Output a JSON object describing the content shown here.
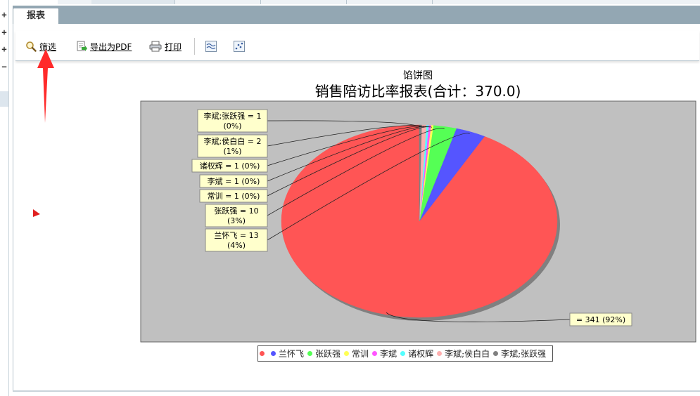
{
  "tab": {
    "label": "报表"
  },
  "toolbar": {
    "filter_label": "筛选",
    "export_pdf_label": "导出为PDF",
    "print_label": "打印"
  },
  "colors": {
    "tabbar": "#93a7b3",
    "plot_bg": "#c0c0c0",
    "label_bg": "#ffffcc",
    "arrow": "#ff2a2a"
  },
  "chart_data": {
    "type": "pie",
    "subtitle": "馅饼图",
    "title": "销售陪访比率报表(合计：370.0)",
    "total": 370.0,
    "series": [
      {
        "name": "兰怀飞",
        "value": 341,
        "label": "= 341 (92%)",
        "color": "#ff5555"
      },
      {
        "name": "张跃强",
        "value": 13,
        "label": "兰怀飞 = 13 (4%)",
        "color": "#5555ff"
      },
      {
        "name": "常训",
        "value": 10,
        "label": "张跃强 = 10 (3%)",
        "color": "#55ff55"
      },
      {
        "name": "李斌",
        "value": 1,
        "label": "常训 = 1 (0%)",
        "color": "#ffff55"
      },
      {
        "name": "诸权辉",
        "value": 1,
        "label": "李斌 = 1 (0%)",
        "color": "#ff55ff"
      },
      {
        "name": "李斌;侯白白",
        "value": 1,
        "label": "诸权辉 = 1 (0%)",
        "color": "#55ffff"
      },
      {
        "name": "李斌;张跃强",
        "value": 2,
        "label": "李斌;侯白白 = 2 (1%)",
        "color": "#ffafaf"
      },
      {
        "name": "",
        "value": 1,
        "label": "李斌;张跃强 = 1 (0%)",
        "color": "#808080"
      }
    ],
    "legend": {
      "placement": "bottom",
      "entries": [
        {
          "name": "",
          "color": "#ff5555"
        },
        {
          "name": "兰怀飞",
          "color": "#5555ff"
        },
        {
          "name": "张跃强",
          "color": "#55ff55"
        },
        {
          "name": "常训",
          "color": "#ffff55"
        },
        {
          "name": "李斌",
          "color": "#ff55ff"
        },
        {
          "name": "诸权辉",
          "color": "#55ffff"
        },
        {
          "name": "李斌;侯白白",
          "color": "#ffafaf"
        },
        {
          "name": "李斌;张跃强",
          "color": "#808080"
        }
      ]
    }
  }
}
